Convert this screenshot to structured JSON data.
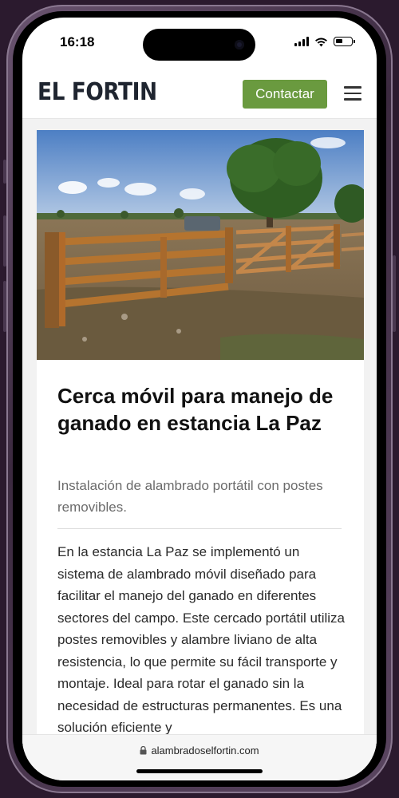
{
  "status": {
    "time": "16:18"
  },
  "header": {
    "logo": "EL FORTIN",
    "contact_label": "Contactar"
  },
  "article": {
    "hero_image": "wooden-cattle-fence-photo",
    "title": "Cerca móvil para manejo de ganado en estancia La Paz",
    "subtitle": "Instalación de alambrado portátil con postes removibles.",
    "body": "En la estancia La Paz se implementó un sistema de alambrado móvil diseñado para facilitar el manejo del ganado en diferentes sectores del campo. Este cercado portátil utiliza postes removibles y alambre liviano de alta resistencia, lo que permite su fácil transporte y montaje. Ideal para rotar el ganado sin la necesidad de estructuras permanentes. Es una solución eficiente y"
  },
  "browser": {
    "url": "alambradoselfortin.com"
  },
  "colors": {
    "accent": "#6a9a3f",
    "logo": "#1f2530",
    "background": "#f2f2f2"
  }
}
